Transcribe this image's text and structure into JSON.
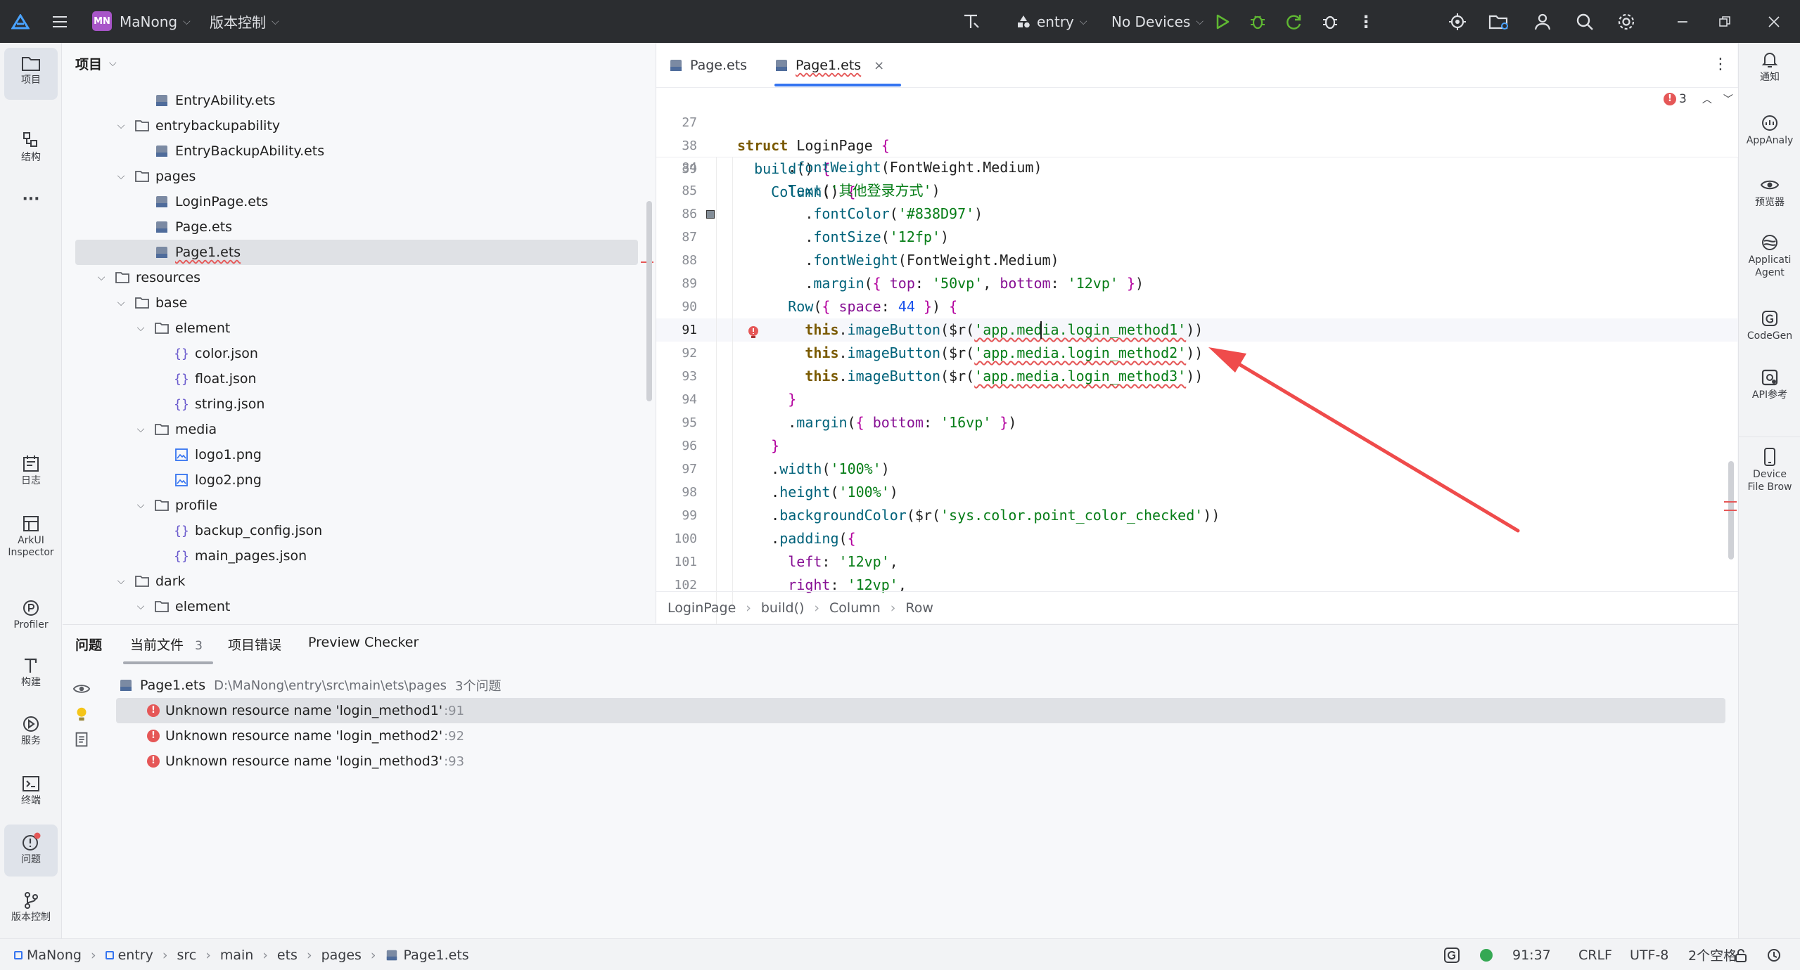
{
  "titlebar": {
    "project_badge": "MN",
    "project_name": "MaNong",
    "vcs_menu": "版本控制",
    "module": "entry",
    "device": "No Devices"
  },
  "left_toolbar": {
    "project": "项目",
    "structure": "结构",
    "more": "···",
    "log": "日志",
    "arkui_1": "ArkUI",
    "arkui_2": "Inspector",
    "profiler": "Profiler",
    "build": "构建",
    "services": "服务",
    "terminal": "终端",
    "problems": "问题",
    "vcs": "版本控制"
  },
  "right_toolbar": {
    "notifications": "通知",
    "appanalyzer": "AppAnaly",
    "previewer": "预览器",
    "agent_1": "Applicati",
    "agent_2": "Agent",
    "codegenie": "CodeGen",
    "api_ref": "API参考",
    "device_file_1": "Device",
    "device_file_2": "File Brow"
  },
  "project_panel": {
    "title": "项目",
    "items": [
      {
        "label": "EntryAbility.ets",
        "type": "ets",
        "expanded": false
      },
      {
        "label": "entrybackupability",
        "type": "folder",
        "expanded": true
      },
      {
        "label": "EntryBackupAbility.ets",
        "type": "ets",
        "expanded": false
      },
      {
        "label": "pages",
        "type": "folder",
        "expanded": true
      },
      {
        "label": "LoginPage.ets",
        "type": "ets",
        "expanded": false
      },
      {
        "label": "Page.ets",
        "type": "ets",
        "expanded": false
      },
      {
        "label": "Page1.ets",
        "type": "ets",
        "expanded": false,
        "selected": true
      },
      {
        "label": "resources",
        "type": "folder",
        "expanded": true
      },
      {
        "label": "base",
        "type": "folder",
        "expanded": true
      },
      {
        "label": "element",
        "type": "folder",
        "expanded": true
      },
      {
        "label": "color.json",
        "type": "json",
        "expanded": false
      },
      {
        "label": "float.json",
        "type": "json",
        "expanded": false
      },
      {
        "label": "string.json",
        "type": "json",
        "expanded": false
      },
      {
        "label": "media",
        "type": "folder",
        "expanded": true
      },
      {
        "label": "logo1.png",
        "type": "image",
        "expanded": false
      },
      {
        "label": "logo2.png",
        "type": "image",
        "expanded": false
      },
      {
        "label": "profile",
        "type": "folder",
        "expanded": true
      },
      {
        "label": "backup_config.json",
        "type": "json",
        "expanded": false
      },
      {
        "label": "main_pages.json",
        "type": "json",
        "expanded": false
      },
      {
        "label": "dark",
        "type": "folder",
        "expanded": true
      },
      {
        "label": "element",
        "type": "folder",
        "expanded": true
      }
    ]
  },
  "editor": {
    "tabs": [
      {
        "label": "Page.ets",
        "active": false
      },
      {
        "label": "Page1.ets",
        "active": true
      }
    ],
    "error_count": "3",
    "sticky_lines": [
      {
        "num": "27",
        "text": "struct LoginPage {"
      },
      {
        "num": "38",
        "text": "  build() {"
      },
      {
        "num": "39",
        "text": "    Column() {"
      }
    ],
    "lines": [
      {
        "num": "84",
        "text": "      .fontWeight(FontWeight.Medium)"
      },
      {
        "num": "85",
        "text": "      Text('其他登录方式')"
      },
      {
        "num": "86",
        "text": "        .fontColor('#838D97')"
      },
      {
        "num": "87",
        "text": "        .fontSize('12fp')"
      },
      {
        "num": "88",
        "text": "        .fontWeight(FontWeight.Medium)"
      },
      {
        "num": "89",
        "text": "        .margin({ top: '50vp', bottom: '12vp' })"
      },
      {
        "num": "90",
        "text": "      Row({ space: 44 }) {"
      },
      {
        "num": "91",
        "text": "        this.imageButton($r('app.media.login_method1'))"
      },
      {
        "num": "92",
        "text": "        this.imageButton($r('app.media.login_method2'))"
      },
      {
        "num": "93",
        "text": "        this.imageButton($r('app.media.login_method3'))"
      },
      {
        "num": "94",
        "text": "      }"
      },
      {
        "num": "95",
        "text": "      .margin({ bottom: '16vp' })"
      },
      {
        "num": "96",
        "text": "    }"
      },
      {
        "num": "97",
        "text": "    .width('100%')"
      },
      {
        "num": "98",
        "text": "    .height('100%')"
      },
      {
        "num": "99",
        "text": "    .backgroundColor($r('sys.color.point_color_checked'))"
      },
      {
        "num": "100",
        "text": "    .padding({"
      },
      {
        "num": "101",
        "text": "      left: '12vp',"
      },
      {
        "num": "102",
        "text": "      right: '12vp',"
      }
    ],
    "breadcrumb": [
      "LoginPage",
      "build()",
      "Column",
      "Row"
    ]
  },
  "problems": {
    "title": "问题",
    "tabs": [
      {
        "label": "当前文件",
        "count": "3",
        "active": true
      },
      {
        "label": "项目错误",
        "count": "",
        "active": false
      },
      {
        "label": "Preview Checker",
        "count": "",
        "active": false
      }
    ],
    "file": {
      "name": "Page1.ets",
      "path": "D:\\MaNong\\entry\\src\\main\\ets\\pages",
      "count": "3个问题"
    },
    "items": [
      {
        "message": "Unknown resource name 'login_method1'",
        "line": ":91"
      },
      {
        "message": "Unknown resource name 'login_method2'",
        "line": ":92"
      },
      {
        "message": "Unknown resource name 'login_method3'",
        "line": ":93"
      }
    ]
  },
  "statusbar": {
    "path": [
      "MaNong",
      "entry",
      "src",
      "main",
      "ets",
      "pages",
      "Page1.ets"
    ],
    "position": "91:37",
    "line_sep": "CRLF",
    "encoding": "UTF-8",
    "indent": "2个空格"
  },
  "colors": {
    "accent": "#3574f0",
    "error": "#e55757",
    "titlebar": "#2b2d30",
    "arrow": "#ef4b4b"
  }
}
